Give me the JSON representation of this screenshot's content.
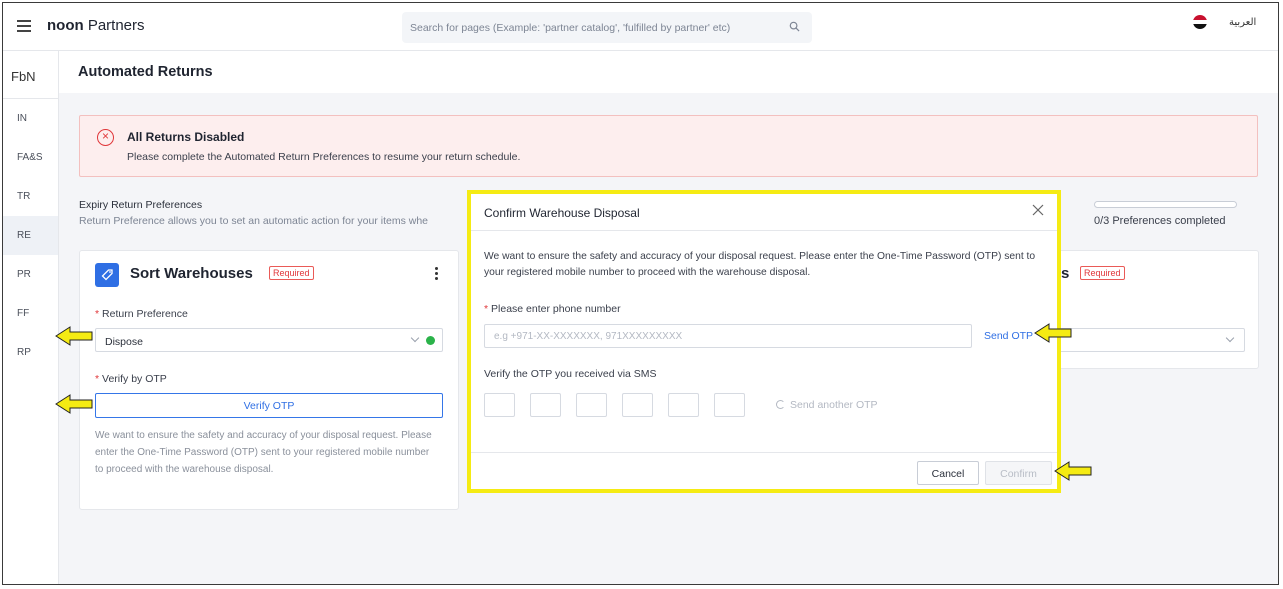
{
  "app": {
    "brand_bold": "noon",
    "brand_rest": " Partners",
    "search_placeholder": "Search for pages (Example: 'partner catalog', 'fulfilled by partner' etc)",
    "language": "العربية"
  },
  "sidebar": {
    "header": "FbN",
    "items": [
      {
        "label": "IN"
      },
      {
        "label": "FA&S"
      },
      {
        "label": "TR"
      },
      {
        "label": "RE"
      },
      {
        "label": "PR"
      },
      {
        "label": "FF"
      },
      {
        "label": "RP"
      }
    ]
  },
  "page": {
    "title": "Automated Returns"
  },
  "alert": {
    "title": "All Returns Disabled",
    "text": "Please complete the Automated Return Preferences to resume your return schedule."
  },
  "expiry": {
    "title": "Expiry Return Preferences",
    "subtitle": "Return Preference allows you to set an automatic action for your items whe",
    "progress_text": "0/3 Preferences completed",
    "progress_value": 0
  },
  "card_sort": {
    "title": "Sort Warehouses",
    "badge": "Required",
    "return_pref_label": "Return Preference",
    "return_pref_value": "Dispose",
    "verify_label": "Verify by OTP",
    "verify_button": "Verify OTP",
    "description": "We want to ensure the safety and accuracy of your disposal request. Please enter the One-Time Password (OTP) sent to your registered mobile number to proceed with the warehouse disposal."
  },
  "card_right": {
    "title_fragment": "s",
    "badge": "Required"
  },
  "modal": {
    "title": "Confirm Warehouse Disposal",
    "description": "We want to ensure the safety and accuracy of your disposal request. Please enter the One-Time Password (OTP) sent to your registered mobile number to proceed with the warehouse disposal.",
    "phone_label": "Please enter phone number",
    "phone_placeholder": "e.g +971-XX-XXXXXXX, 971XXXXXXXXX",
    "send_otp": "Send OTP",
    "otp_label": "Verify the OTP you received via SMS",
    "otp_boxes": 6,
    "resend": "Send another OTP",
    "cancel": "Cancel",
    "confirm": "Confirm"
  },
  "colors": {
    "accent": "#2f6fe4",
    "error": "#e0373a",
    "highlight": "#f5eb13",
    "success": "#2bb34a"
  }
}
